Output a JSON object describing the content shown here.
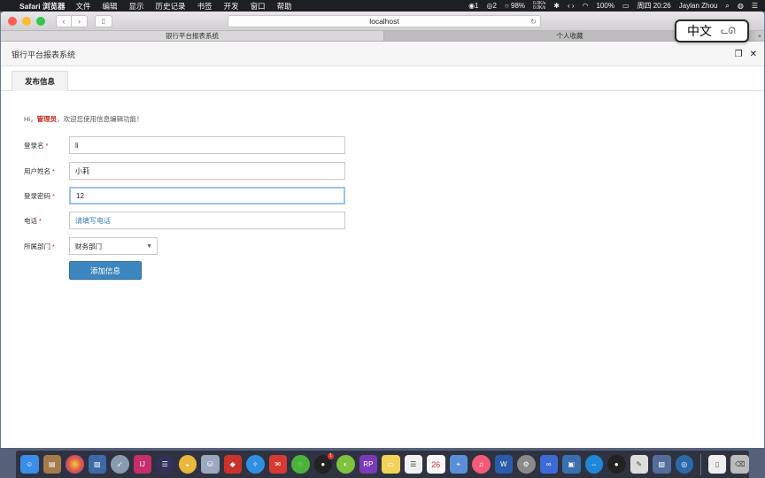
{
  "menubar": {
    "app_name": "Safari 浏览器",
    "items": [
      "文件",
      "编辑",
      "显示",
      "历史记录",
      "书签",
      "开发",
      "窗口",
      "帮助"
    ],
    "status": {
      "wechat_count": "1",
      "qq_count": "2",
      "battery_ring": "98%",
      "net_up": "0.0K/s",
      "net_down": "0.0K/s",
      "battery": "100%",
      "clock": "周四 20:26",
      "user": "Jaylan Zhou"
    }
  },
  "browser": {
    "address": "localhost",
    "tabs": [
      "银行平台报表系统",
      "个人收藏"
    ]
  },
  "ime": {
    "label": "中文"
  },
  "page": {
    "header_title": "银行平台报表系统",
    "tab_label": "发布信息",
    "greeting": {
      "prefix": "Hi，",
      "name": "管理员",
      "suffix": "，欢迎您使用信息编辑功能！"
    },
    "form": {
      "login_label": "登录名",
      "login_value": "li",
      "name_label": "用户姓名",
      "name_value": "小莉",
      "password_label": "登录密码",
      "password_value": "12",
      "phone_label": "电话",
      "phone_placeholder": "请填写电话",
      "dept_label": "所属部门",
      "dept_value": "财务部门",
      "required_mark": "*",
      "submit_label": "添加信息"
    }
  },
  "dock": {
    "calendar_day": "26",
    "badge_qq": "1",
    "rp_label": "RP"
  }
}
